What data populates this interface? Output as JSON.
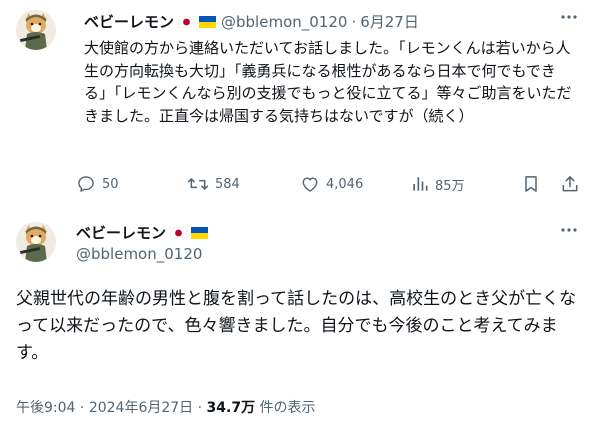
{
  "tweet1": {
    "display_name": "ベビーレモン",
    "handle": "@bblemon_0120",
    "separator": "·",
    "date": "6月27日",
    "text": "大使館の方から連絡いただいてお話しました。「レモンくんは若いから人生の方向転換も大切」「義勇兵になる根性があるなら日本で何でもできる」「レモンくんなら別の支援でもっと役に立てる」等々ご助言をいただきました。正直今は帰国する気持ちはないですが（続く）",
    "replies": "50",
    "reposts": "584",
    "likes": "4,046",
    "views": "85万"
  },
  "tweet2": {
    "display_name": "ベビーレモン",
    "handle": "@bblemon_0120",
    "text": "父親世代の年齢の男性と腹を割って話したのは、高校生のとき父が亡くなって以来だったので、色々響きました。自分でも今後のこと考えてみます。",
    "time": "午後9:04",
    "dot": "·",
    "date": "2024年6月27日",
    "views_count": "34.7万",
    "views_label": "件の表示"
  },
  "flags": [
    "japan-flag",
    "ukraine-flag"
  ],
  "icons": [
    "reply-icon",
    "repost-icon",
    "like-icon",
    "views-icon",
    "bookmark-icon",
    "share-icon",
    "more-icon"
  ],
  "colors": {
    "text": "#0f1419",
    "muted": "#536471",
    "flag_red": "#bc002d",
    "ukraine_blue": "#0057b7",
    "ukraine_yellow": "#ffd700"
  }
}
